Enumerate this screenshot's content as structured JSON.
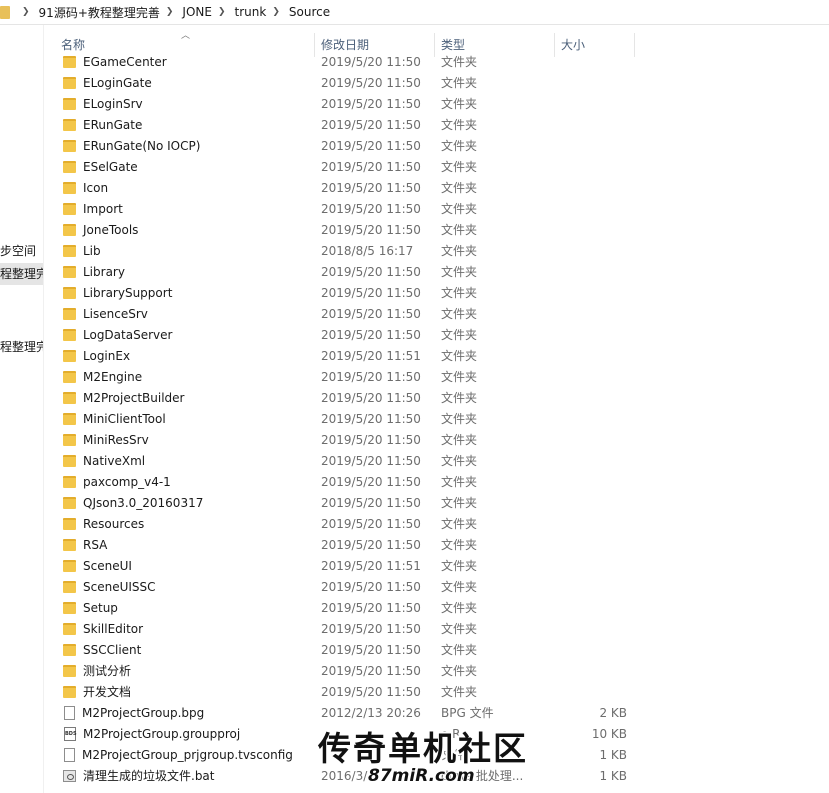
{
  "breadcrumbs": [
    "91源码+教程整理完善",
    "JONE",
    "trunk",
    "Source"
  ],
  "sidebar": {
    "items": [
      {
        "label": "步空间",
        "selected": false
      },
      {
        "label": "程整理完",
        "selected": true
      },
      {
        "label": "程整理完",
        "selected": false
      }
    ]
  },
  "columns": {
    "name": "名称",
    "date": "修改日期",
    "type": "类型",
    "size": "大小"
  },
  "files": [
    {
      "name": "EGameCenter",
      "date": "2019/5/20 11:50",
      "type": "文件夹",
      "size": "",
      "kind": "folder"
    },
    {
      "name": "ELoginGate",
      "date": "2019/5/20 11:50",
      "type": "文件夹",
      "size": "",
      "kind": "folder"
    },
    {
      "name": "ELoginSrv",
      "date": "2019/5/20 11:50",
      "type": "文件夹",
      "size": "",
      "kind": "folder"
    },
    {
      "name": "ERunGate",
      "date": "2019/5/20 11:50",
      "type": "文件夹",
      "size": "",
      "kind": "folder"
    },
    {
      "name": "ERunGate(No IOCP)",
      "date": "2019/5/20 11:50",
      "type": "文件夹",
      "size": "",
      "kind": "folder"
    },
    {
      "name": "ESelGate",
      "date": "2019/5/20 11:50",
      "type": "文件夹",
      "size": "",
      "kind": "folder"
    },
    {
      "name": "Icon",
      "date": "2019/5/20 11:50",
      "type": "文件夹",
      "size": "",
      "kind": "folder"
    },
    {
      "name": "Import",
      "date": "2019/5/20 11:50",
      "type": "文件夹",
      "size": "",
      "kind": "folder"
    },
    {
      "name": "JoneTools",
      "date": "2019/5/20 11:50",
      "type": "文件夹",
      "size": "",
      "kind": "folder"
    },
    {
      "name": "Lib",
      "date": "2018/8/5 16:17",
      "type": "文件夹",
      "size": "",
      "kind": "folder"
    },
    {
      "name": "Library",
      "date": "2019/5/20 11:50",
      "type": "文件夹",
      "size": "",
      "kind": "folder"
    },
    {
      "name": "LibrarySupport",
      "date": "2019/5/20 11:50",
      "type": "文件夹",
      "size": "",
      "kind": "folder"
    },
    {
      "name": "LisenceSrv",
      "date": "2019/5/20 11:50",
      "type": "文件夹",
      "size": "",
      "kind": "folder"
    },
    {
      "name": "LogDataServer",
      "date": "2019/5/20 11:50",
      "type": "文件夹",
      "size": "",
      "kind": "folder"
    },
    {
      "name": "LoginEx",
      "date": "2019/5/20 11:51",
      "type": "文件夹",
      "size": "",
      "kind": "folder"
    },
    {
      "name": "M2Engine",
      "date": "2019/5/20 11:50",
      "type": "文件夹",
      "size": "",
      "kind": "folder"
    },
    {
      "name": "M2ProjectBuilder",
      "date": "2019/5/20 11:50",
      "type": "文件夹",
      "size": "",
      "kind": "folder"
    },
    {
      "name": "MiniClientTool",
      "date": "2019/5/20 11:50",
      "type": "文件夹",
      "size": "",
      "kind": "folder"
    },
    {
      "name": "MiniResSrv",
      "date": "2019/5/20 11:50",
      "type": "文件夹",
      "size": "",
      "kind": "folder"
    },
    {
      "name": "NativeXml",
      "date": "2019/5/20 11:50",
      "type": "文件夹",
      "size": "",
      "kind": "folder"
    },
    {
      "name": "paxcomp_v4-1",
      "date": "2019/5/20 11:50",
      "type": "文件夹",
      "size": "",
      "kind": "folder"
    },
    {
      "name": "QJson3.0_20160317",
      "date": "2019/5/20 11:50",
      "type": "文件夹",
      "size": "",
      "kind": "folder"
    },
    {
      "name": "Resources",
      "date": "2019/5/20 11:50",
      "type": "文件夹",
      "size": "",
      "kind": "folder"
    },
    {
      "name": "RSA",
      "date": "2019/5/20 11:50",
      "type": "文件夹",
      "size": "",
      "kind": "folder"
    },
    {
      "name": "SceneUI",
      "date": "2019/5/20 11:51",
      "type": "文件夹",
      "size": "",
      "kind": "folder"
    },
    {
      "name": "SceneUISSC",
      "date": "2019/5/20 11:50",
      "type": "文件夹",
      "size": "",
      "kind": "folder"
    },
    {
      "name": "Setup",
      "date": "2019/5/20 11:50",
      "type": "文件夹",
      "size": "",
      "kind": "folder"
    },
    {
      "name": "SkillEditor",
      "date": "2019/5/20 11:50",
      "type": "文件夹",
      "size": "",
      "kind": "folder"
    },
    {
      "name": "SSCClient",
      "date": "2019/5/20 11:50",
      "type": "文件夹",
      "size": "",
      "kind": "folder"
    },
    {
      "name": "测试分析",
      "date": "2019/5/20 11:50",
      "type": "文件夹",
      "size": "",
      "kind": "folder"
    },
    {
      "name": "开发文档",
      "date": "2019/5/20 11:50",
      "type": "文件夹",
      "size": "",
      "kind": "folder"
    },
    {
      "name": "M2ProjectGroup.bpg",
      "date": "2012/2/13 20:26",
      "type": "BPG 文件",
      "size": "2 KB",
      "kind": "file"
    },
    {
      "name": "M2ProjectGroup.groupproj",
      "date": "",
      "type": "o R...",
      "size": "10 KB",
      "kind": "bds"
    },
    {
      "name": "M2ProjectGroup_prjgroup.tvsconfig",
      "date": "",
      "type": "文件",
      "size": "1 KB",
      "kind": "file"
    },
    {
      "name": "清理生成的垃圾文件.bat",
      "date": "2016/3/",
      "type": "dows 批处理...",
      "size": "1 KB",
      "kind": "bat"
    }
  ],
  "watermark": {
    "main": "传奇单机社区",
    "sub": "87miR.com"
  }
}
